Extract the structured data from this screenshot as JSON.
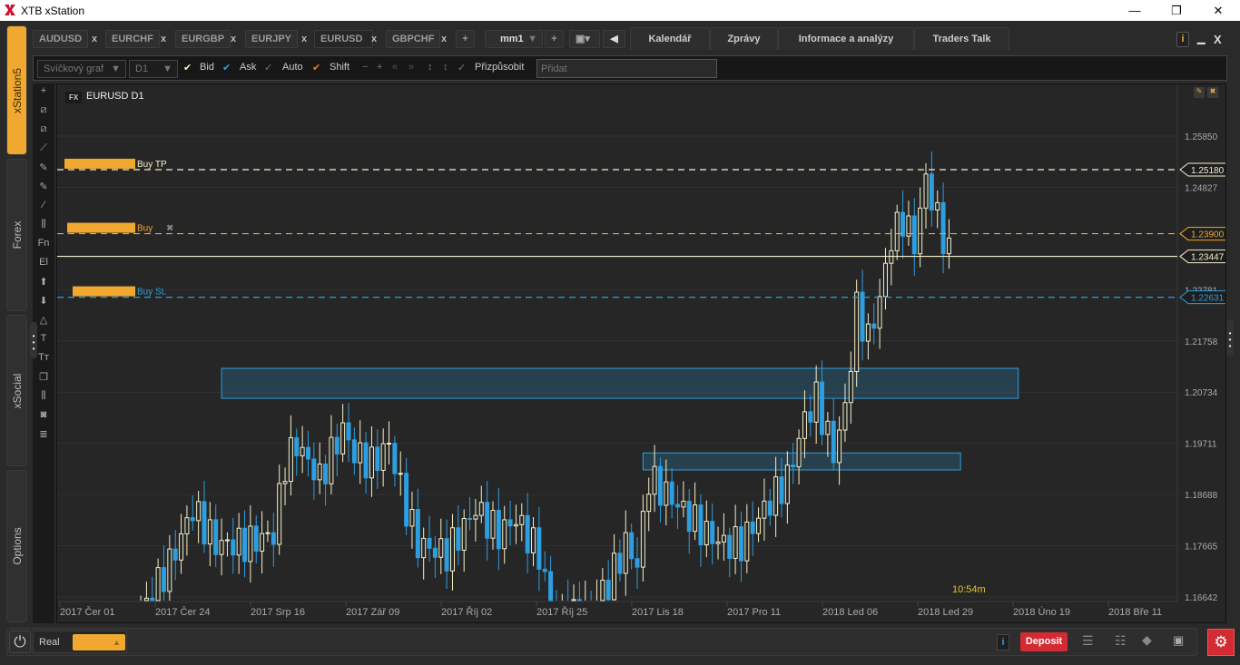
{
  "window": {
    "title": "XTB xStation",
    "minimize": "—",
    "maximize": "❐",
    "close": "✕"
  },
  "side_tabs": [
    {
      "label": "xStation5",
      "active": true
    },
    {
      "label": "Forex"
    },
    {
      "label": "xSocial"
    },
    {
      "label": "Options"
    }
  ],
  "symbol_tabs": [
    {
      "label": "AUDUSD"
    },
    {
      "label": "EURCHF"
    },
    {
      "label": "EURGBP"
    },
    {
      "label": "EURJPY"
    },
    {
      "label": "EURUSD"
    },
    {
      "label": "GBPCHF"
    }
  ],
  "tab_close": "x",
  "add_tab": "+",
  "layout_select": "mm1",
  "layout_add": "+",
  "right_tabs": [
    "Kalendář",
    "Zprávy",
    "Informace a analýzy",
    "Traders Talk"
  ],
  "toolbar": {
    "chart_type": "Svíčkový graf",
    "interval": "D1",
    "bid": "Bid",
    "ask": "Ask",
    "auto": "Auto",
    "shift": "Shift",
    "minus": "−",
    "plus": "+",
    "fit": "Přizpůsobit",
    "add_placeholder": "Přidat"
  },
  "left_tools": [
    "+",
    "⧄",
    "⧄",
    "⟋",
    "✎",
    "✎",
    "⁄",
    "⫼",
    "Fn",
    "El",
    "⬆",
    "⬇",
    "△",
    "T",
    "Tт",
    "❐",
    "⫼",
    "◙",
    "≣"
  ],
  "chart": {
    "badge": "FX",
    "title": "EURUSD D1",
    "countdown": "10:54m",
    "price_ticks": [
      "1.25850",
      "1.24827",
      "1.22781",
      "1.21758",
      "1.20734",
      "1.19711",
      "1.18688",
      "1.17665",
      "1.16642"
    ],
    "date_labels": [
      "2017 Čer 01",
      "2017 Čer 24",
      "2017 Srp 16",
      "2017 Zář 09",
      "2017 Říj 02",
      "2017 Říj 25",
      "2017 Lis 18",
      "2017 Pro 11",
      "2018 Led 06",
      "2018 Led 29",
      "2018 Úno 19",
      "2018 Bře 11"
    ]
  },
  "orders": [
    {
      "label": "Buy  TP",
      "price": 1.2518,
      "price_text": "1.25180",
      "color": "#f5f0d0",
      "dash": true
    },
    {
      "label": "Buy",
      "price": 1.239,
      "price_text": "1.23900",
      "color": "#f0a830",
      "dash": true,
      "close_icon": "✖"
    },
    {
      "label": "",
      "price": 1.23447,
      "price_text": "1.23447",
      "color": "#f5f0d0",
      "dash": false
    },
    {
      "label": "Buy  SL",
      "price": 1.22631,
      "price_text": "1.22631",
      "color": "#2d9ee0",
      "dash": true
    }
  ],
  "chart_data": {
    "type": "candlestick",
    "symbol": "EURUSD",
    "timeframe": "D1",
    "ylim": [
      1.16642,
      1.2585
    ],
    "close_keypoints": [
      [
        0,
        1.118
      ],
      [
        14,
        1.163
      ],
      [
        19,
        1.173
      ],
      [
        23,
        1.184
      ],
      [
        27,
        1.177
      ],
      [
        32,
        1.177
      ],
      [
        37,
        1.179
      ],
      [
        39,
        1.193
      ],
      [
        41,
        1.197
      ],
      [
        45,
        1.19
      ],
      [
        49,
        1.2
      ],
      [
        51,
        1.195
      ],
      [
        54,
        1.193
      ],
      [
        57,
        1.197
      ],
      [
        60,
        1.184
      ],
      [
        62,
        1.177
      ],
      [
        67,
        1.175
      ],
      [
        72,
        1.184
      ],
      [
        76,
        1.179
      ],
      [
        79,
        1.182
      ],
      [
        83,
        1.175
      ],
      [
        85,
        1.164
      ],
      [
        90,
        1.162
      ],
      [
        95,
        1.169
      ],
      [
        98,
        1.177
      ],
      [
        100,
        1.173
      ],
      [
        102,
        1.19
      ],
      [
        106,
        1.186
      ],
      [
        112,
        1.179
      ],
      [
        115,
        1.177
      ],
      [
        118,
        1.177
      ],
      [
        122,
        1.184
      ],
      [
        126,
        1.19
      ],
      [
        129,
        1.202
      ],
      [
        131,
        1.206
      ],
      [
        134,
        1.195
      ],
      [
        136,
        1.204
      ],
      [
        138,
        1.224
      ],
      [
        140,
        1.218
      ],
      [
        142,
        1.226
      ],
      [
        144,
        1.238
      ],
      [
        146,
        1.242
      ],
      [
        148,
        1.237
      ],
      [
        150,
        1.25
      ],
      [
        152,
        1.242
      ],
      [
        154,
        1.235
      ]
    ],
    "zones": [
      {
        "from": 28,
        "to": 166,
        "high": 1.2121,
        "low": 1.2061
      },
      {
        "from": 101,
        "to": 156,
        "high": 1.1952,
        "low": 1.1918
      }
    ],
    "colors": {
      "up": "#f5f0c8",
      "down": "#2d9ee0"
    }
  },
  "bottom": {
    "account": "Real",
    "deposit": "Deposit",
    "info": "i"
  }
}
